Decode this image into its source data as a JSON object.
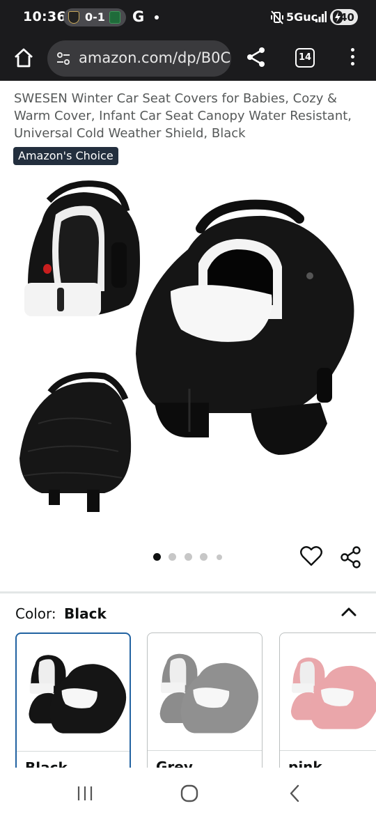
{
  "status_bar": {
    "time": "10:36",
    "score": "0-1",
    "g_glyph": "G",
    "network": "5Guc",
    "battery": "40",
    "icons": [
      "lafc-logo-icon",
      "austin-fc-logo-icon",
      "google-icon",
      "notification-dot-icon",
      "vibrate-mute-icon",
      "signal-icon",
      "battery-saver-icon"
    ]
  },
  "browser": {
    "url": "amazon.com/dp/B0C",
    "tab_count": "14",
    "icons": [
      "home-icon",
      "site-settings-icon",
      "share-icon",
      "tabs-icon",
      "overflow-menu-icon"
    ]
  },
  "product": {
    "title": "SWESEN Winter Car Seat Covers for Babies, Cozy & Warm Cover, Infant Car Seat Canopy Water Resistant, Universal Cold Weather Shield, Black",
    "badge": "Amazon's Choice",
    "image_count": 5,
    "active_image": 1
  },
  "color_selector": {
    "label": "Color:",
    "selected": "Black",
    "options": [
      {
        "label": "Black",
        "selected": true
      },
      {
        "label": "Grey",
        "selected": false
      },
      {
        "label": "pink",
        "selected": false
      }
    ]
  },
  "colors": {
    "system_bar": "#1b1b1d",
    "badge_bg": "#232f3e",
    "selected_border": "#2162a1",
    "seat_black": "#141414",
    "seat_grey": "#8c8c8c",
    "seat_pink": "#e9a7ab"
  }
}
